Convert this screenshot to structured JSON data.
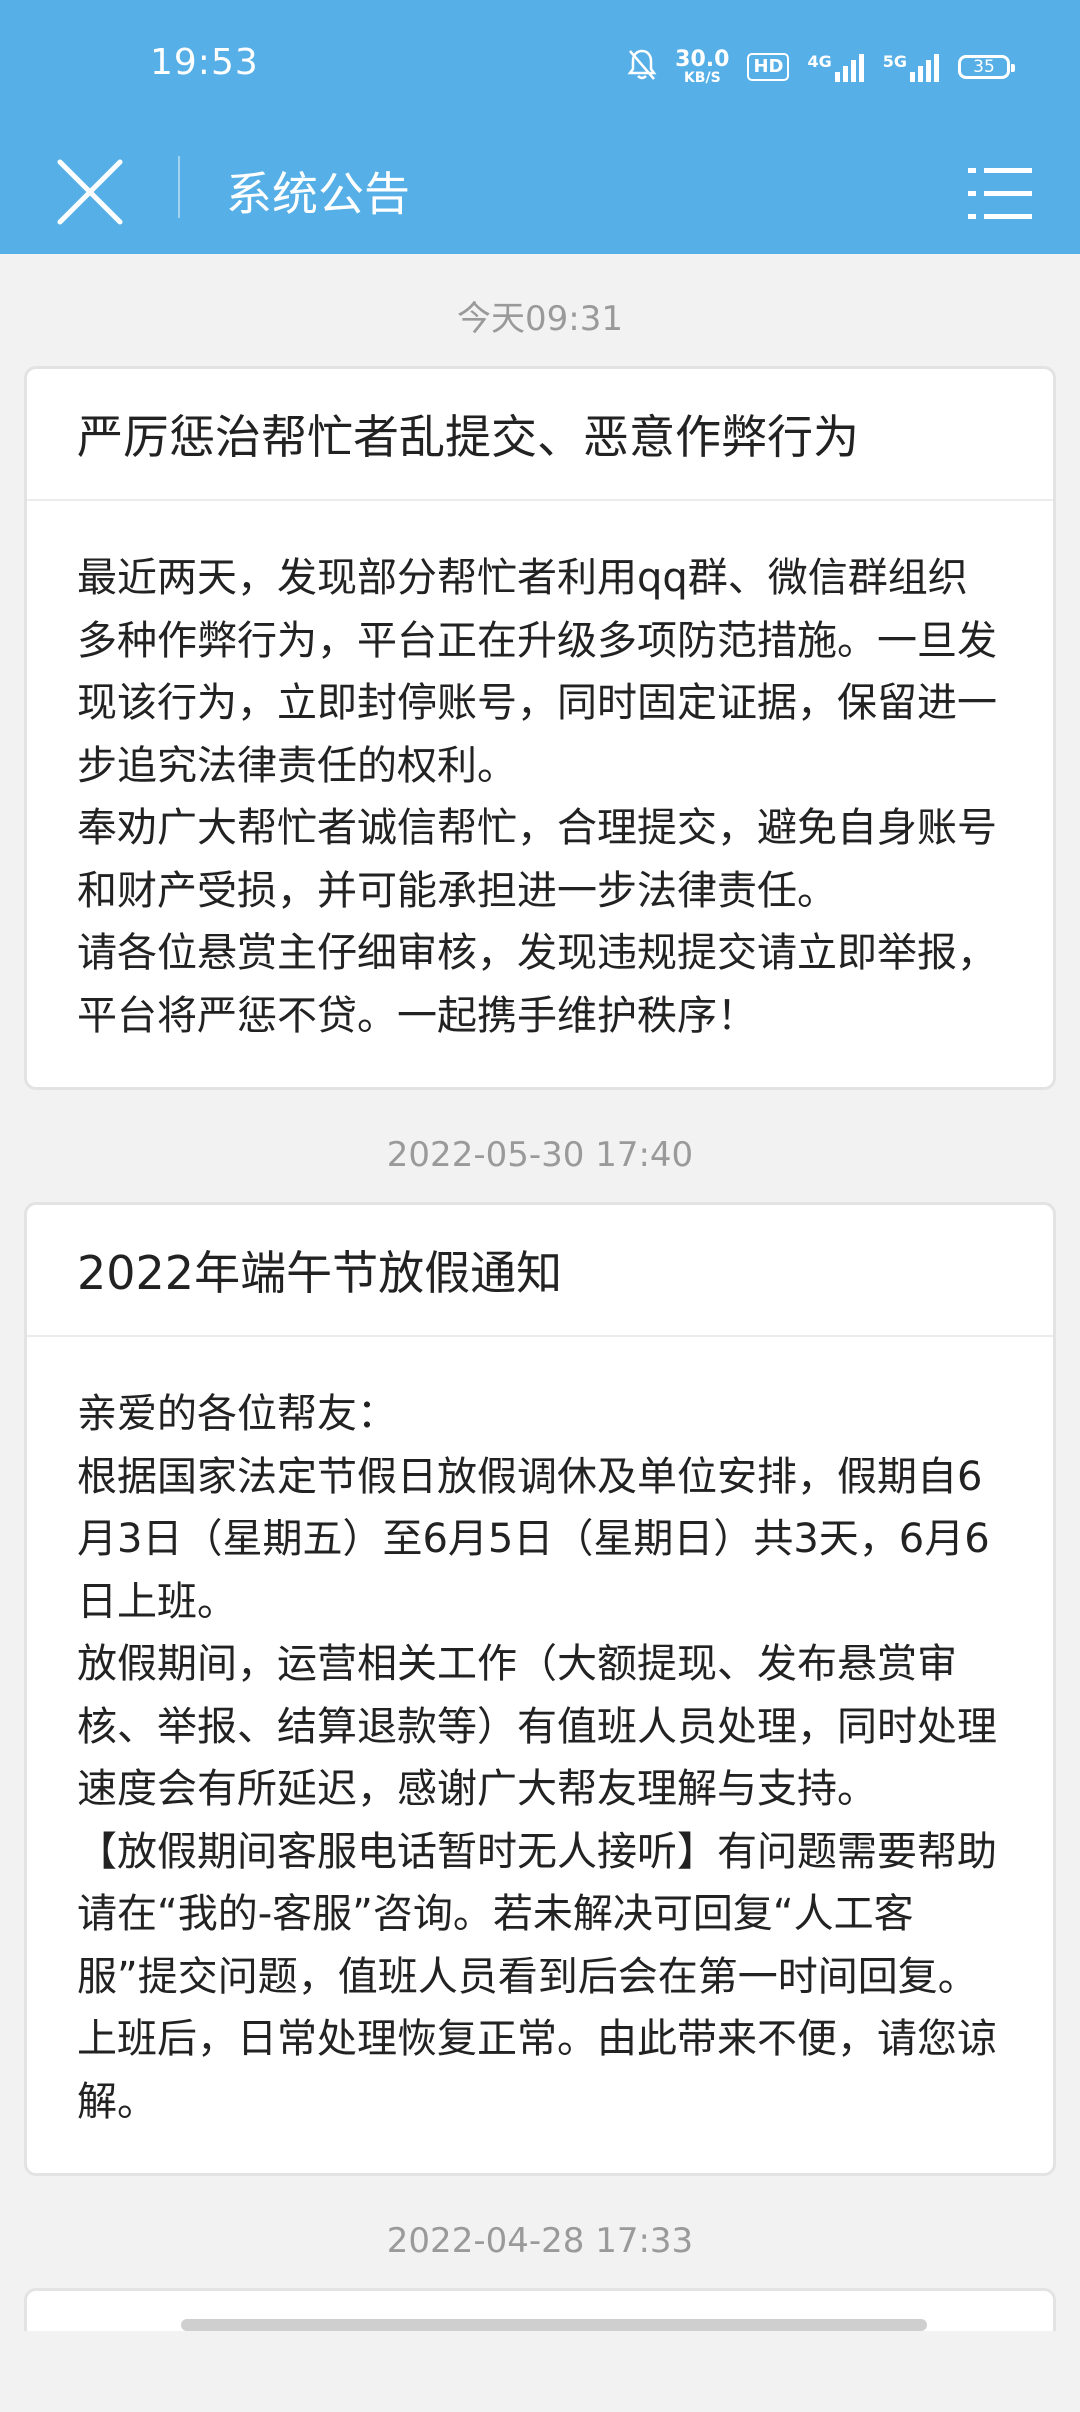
{
  "status_bar": {
    "time": "19:53",
    "net_speed_value": "30.0",
    "net_speed_unit": "KB/S",
    "hd_badge": "HD",
    "network_4g": "4G",
    "network_5g": "5G",
    "battery": "35",
    "icons": [
      "bell-muted-icon",
      "signal-4g-icon",
      "signal-5g-icon",
      "battery-icon"
    ],
    "color": "#56afe6"
  },
  "header": {
    "title": "系统公告",
    "close_icon": "close-icon",
    "menu_icon": "list-menu-icon"
  },
  "announcements": [
    {
      "timestamp": "今天09:31",
      "title": "严厉惩治帮忙者乱提交、恶意作弊行为",
      "paragraphs": [
        "最近两天，发现部分帮忙者利用qq群、微信群组织多种作弊行为，平台正在升级多项防范措施。一旦发现该行为，立即封停账号，同时固定证据，保留进一步追究法律责任的权利。",
        "奉劝广大帮忙者诚信帮忙，合理提交，避免自身账号和财产受损，并可能承担进一步法律责任。",
        "请各位悬赏主仔细审核，发现违规提交请立即举报，平台将严惩不贷。一起携手维护秩序！"
      ]
    },
    {
      "timestamp": "2022-05-30 17:40",
      "title": "2022年端午节放假通知",
      "paragraphs": [
        "亲爱的各位帮友：",
        "根据国家法定节假日放假调休及单位安排，假期自6月3日（星期五）至6月5日（星期日）共3天，6月6日上班。",
        "放假期间，运营相关工作（大额提现、发布悬赏审核、举报、结算退款等）有值班人员处理，同时处理速度会有所延迟，感谢广大帮友理解与支持。",
        "【放假期间客服电话暂时无人接听】有问题需要帮助请在“我的-客服”咨询。若未解决可回复“人工客服”提交问题，值班人员看到后会在第一时间回复。",
        "上班后，日常处理恢复正常。由此带来不便，请您谅解。"
      ]
    },
    {
      "timestamp": "2022-04-28 17:33"
    }
  ]
}
